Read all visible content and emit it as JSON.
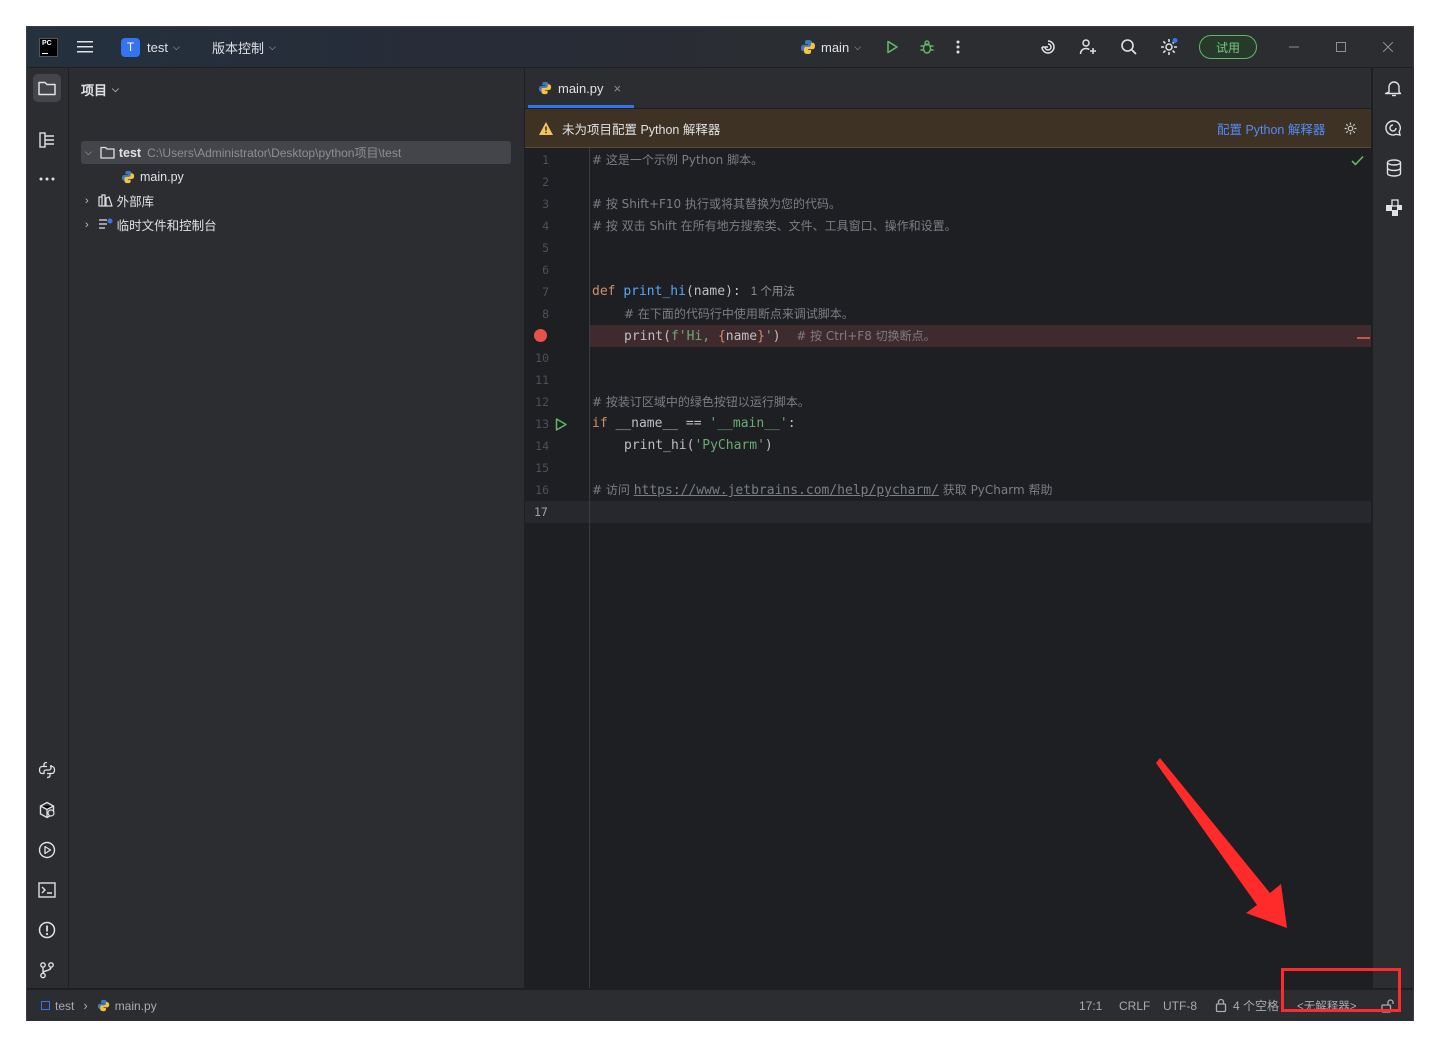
{
  "titlebar": {
    "logo_text": "PC",
    "project_badge": "T",
    "project_name": "test",
    "vcs_label": "版本控制",
    "run_config": "main",
    "trial_label": "试用"
  },
  "project_panel": {
    "header": "项目",
    "root_name": "test",
    "root_path": "C:\\Users\\Administrator\\Desktop\\python项目\\test",
    "file_main": "main.py",
    "external_libs": "外部库",
    "scratches": "临时文件和控制台"
  },
  "editor": {
    "tab_label": "main.py",
    "banner_text": "未为项目配置 Python 解释器",
    "banner_action": "配置 Python 解释器",
    "line_numbers": [
      "1",
      "2",
      "3",
      "4",
      "5",
      "6",
      "7",
      "8",
      "",
      "10",
      "11",
      "12",
      "13",
      "14",
      "15",
      "16",
      "17"
    ],
    "lines": {
      "l1": "# 这是一个示例 Python 脚本。",
      "l3": "# 按 Shift+F10 执行或将其替换为您的代码。",
      "l4": "# 按 双击 Shift 在所有地方搜索类、文件、工具窗口、操作和设置。",
      "l7_kw": "def",
      "l7_fn": "print_hi",
      "l7_args": "(name):",
      "l7_hint": "1 个用法",
      "l8": "# 在下面的代码行中使用断点来调试脚本。",
      "l9_a": "print(",
      "l9_str1": "f'Hi, ",
      "l9_b1": "{",
      "l9_name": "name",
      "l9_b2": "}",
      "l9_str2": "'",
      "l9_c": ")",
      "l9_cmt": "# 按 Ctrl+F8 切换断点。",
      "l12": "# 按装订区域中的绿色按钮以运行脚本。",
      "l13_kw": "if",
      "l13_a": " __name__ == ",
      "l13_str": "'__main__'",
      "l13_b": ":",
      "l14_a": "print_hi(",
      "l14_str": "'PyCharm'",
      "l14_b": ")",
      "l16_a": "# 访问 ",
      "l16_link": "https://www.jetbrains.com/help/pycharm/",
      "l16_b": " 获取 PyCharm 帮助"
    }
  },
  "statusbar": {
    "crumb_project": "test",
    "crumb_file": "main.py",
    "position": "17:1",
    "line_sep": "CRLF",
    "encoding": "UTF-8",
    "indent": "4 个空格",
    "interpreter": "<无解释器>"
  },
  "colors": {
    "accent": "#3574f0",
    "annotation": "#ff2b2b",
    "run_green": "#5fb865",
    "breakpoint": "#e5534b"
  }
}
